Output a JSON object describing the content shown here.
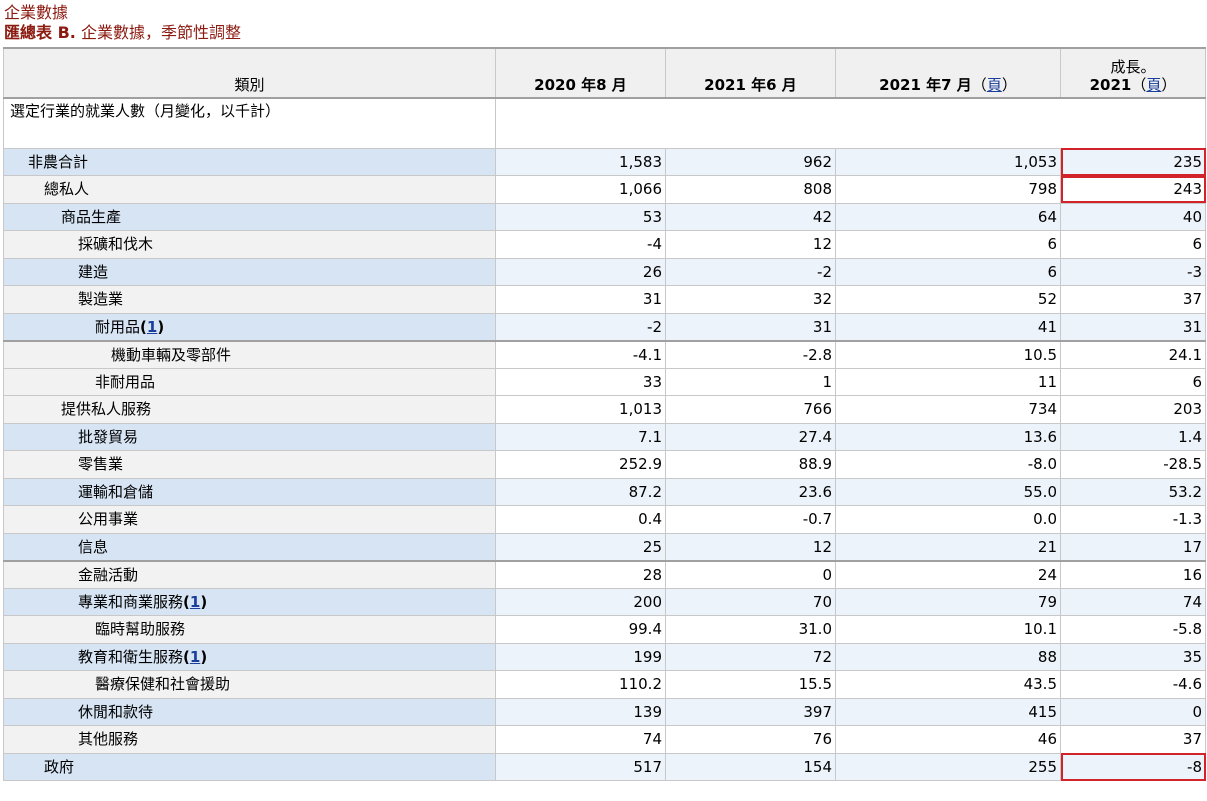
{
  "title": {
    "line1": "企業數據",
    "line2_bold": "匯總表 B.",
    "line2_rest": " 企業數據，季節性調整"
  },
  "header": {
    "category": "類別",
    "col1": "2020 年8 月",
    "col2": "2021 年6 月",
    "col3_text": "2021 年7 月",
    "col3_open": "（",
    "col3_link": "頁",
    "col3_close": "）",
    "col4_line1": "成長。",
    "col4_year": "2021",
    "col4_open": "（",
    "col4_link": "頁",
    "col4_close": "）"
  },
  "section": {
    "label": "選定行業的就業人數（月變化，以千計）"
  },
  "rows": [
    {
      "label": "非農合計",
      "fn": "",
      "values": [
        "1,583",
        "962",
        "1,053",
        "235"
      ]
    },
    {
      "label": "總私人",
      "fn": "",
      "values": [
        "1,066",
        "808",
        "798",
        "243"
      ]
    },
    {
      "label": "商品生產",
      "fn": "",
      "values": [
        "53",
        "42",
        "64",
        "40"
      ]
    },
    {
      "label": "採礦和伐木",
      "fn": "",
      "values": [
        "-4",
        "12",
        "6",
        "6"
      ]
    },
    {
      "label": "建造",
      "fn": "",
      "values": [
        "26",
        "-2",
        "6",
        "-3"
      ]
    },
    {
      "label": "製造業",
      "fn": "",
      "values": [
        "31",
        "32",
        "52",
        "37"
      ]
    },
    {
      "label": "耐用品",
      "fn": "1",
      "values": [
        "-2",
        "31",
        "41",
        "31"
      ]
    },
    {
      "label": "機動車輛及零部件",
      "fn": "",
      "values": [
        "-4.1",
        "-2.8",
        "10.5",
        "24.1"
      ]
    },
    {
      "label": "非耐用品",
      "fn": "",
      "values": [
        "33",
        "1",
        "11",
        "6"
      ]
    },
    {
      "label": "提供私人服務",
      "fn": "",
      "values": [
        "1,013",
        "766",
        "734",
        "203"
      ]
    },
    {
      "label": "批發貿易",
      "fn": "",
      "values": [
        "7.1",
        "27.4",
        "13.6",
        "1.4"
      ]
    },
    {
      "label": "零售業",
      "fn": "",
      "values": [
        "252.9",
        "88.9",
        "-8.0",
        "-28.5"
      ]
    },
    {
      "label": "運輸和倉儲",
      "fn": "",
      "values": [
        "87.2",
        "23.6",
        "55.0",
        "53.2"
      ]
    },
    {
      "label": "公用事業",
      "fn": "",
      "values": [
        "0.4",
        "-0.7",
        "0.0",
        "-1.3"
      ]
    },
    {
      "label": "信息",
      "fn": "",
      "values": [
        "25",
        "12",
        "21",
        "17"
      ]
    },
    {
      "label": "金融活動",
      "fn": "",
      "values": [
        "28",
        "0",
        "24",
        "16"
      ]
    },
    {
      "label": "專業和商業服務",
      "fn": "1",
      "values": [
        "200",
        "70",
        "79",
        "74"
      ]
    },
    {
      "label": "臨時幫助服務",
      "fn": "",
      "values": [
        "99.4",
        "31.0",
        "10.1",
        "-5.8"
      ]
    },
    {
      "label": "教育和衛生服務",
      "fn": "1",
      "values": [
        "199",
        "72",
        "88",
        "35"
      ]
    },
    {
      "label": "醫療保健和社會援助",
      "fn": "",
      "values": [
        "110.2",
        "15.5",
        "43.5",
        "-4.6"
      ]
    },
    {
      "label": "休閒和款待",
      "fn": "",
      "values": [
        "139",
        "397",
        "415",
        "0"
      ]
    },
    {
      "label": "其他服務",
      "fn": "",
      "values": [
        "74",
        "76",
        "46",
        "37"
      ]
    },
    {
      "label": "政府",
      "fn": "",
      "values": [
        "517",
        "154",
        "255",
        "-8"
      ]
    }
  ],
  "colors": {
    "title": "#8b1a10",
    "highlight": "#d2232a",
    "link": "#1a3e9c",
    "row_alt_label": "#d6e4f4",
    "row_alt_value": "#edf3fa"
  }
}
